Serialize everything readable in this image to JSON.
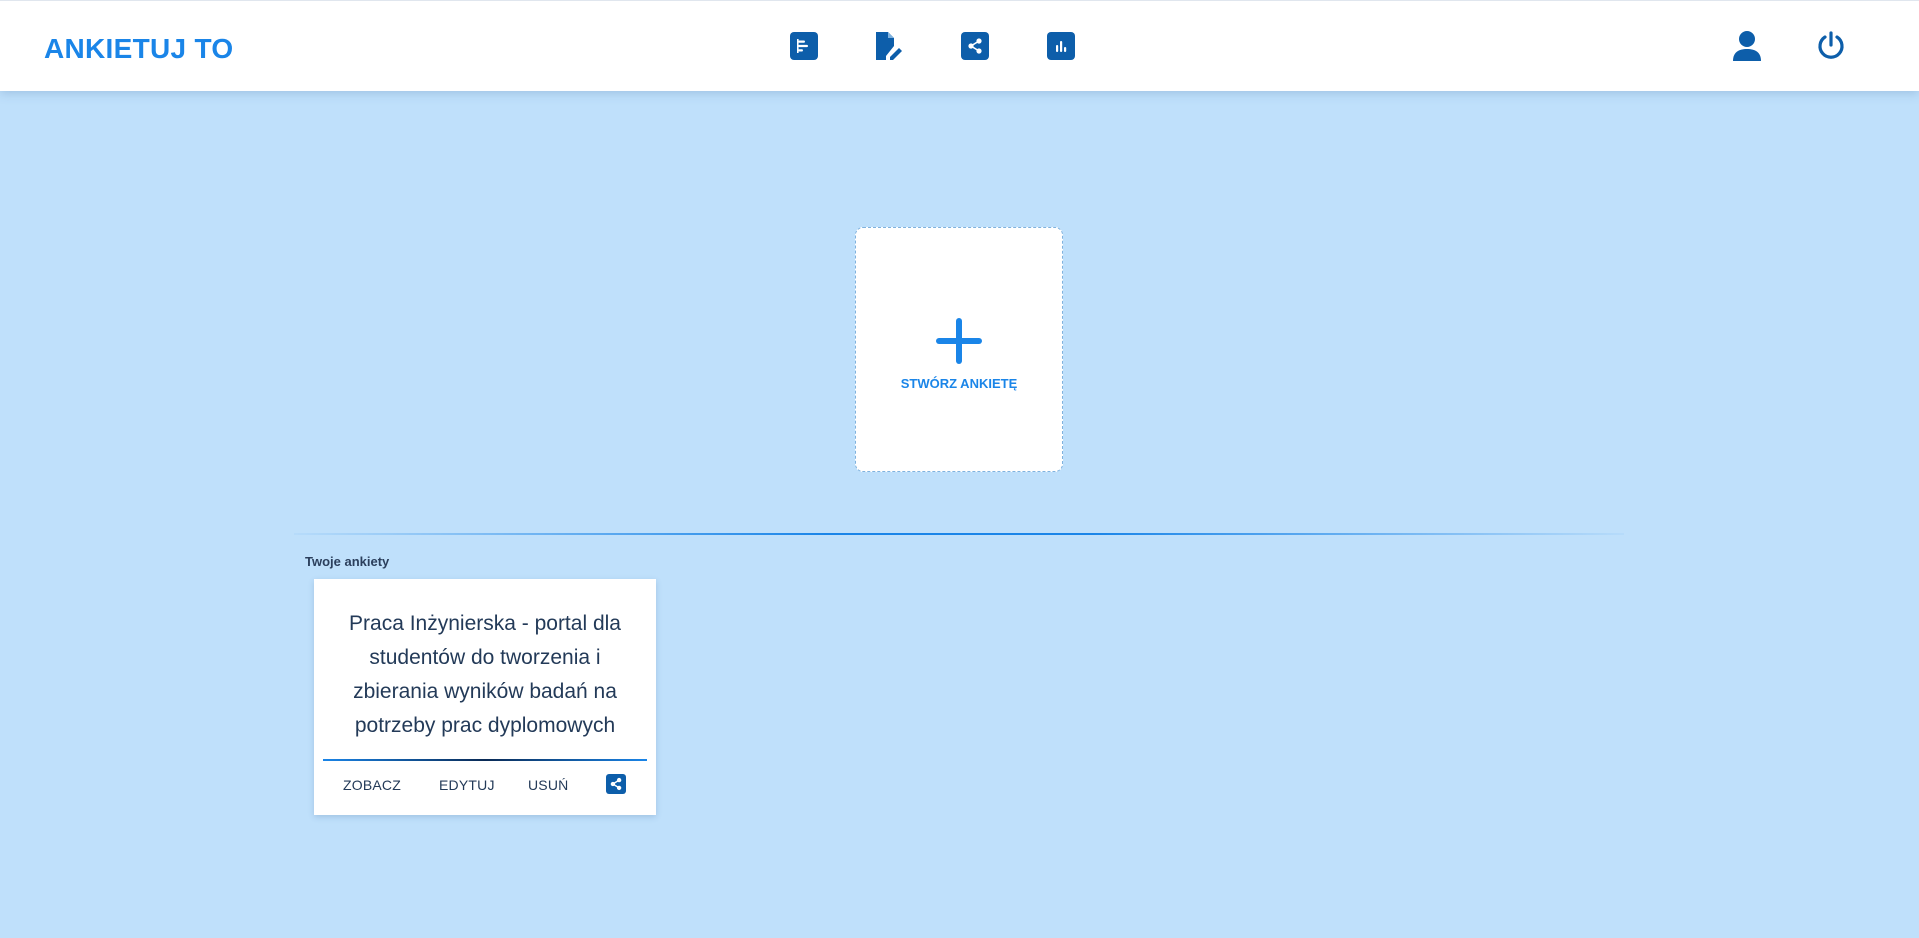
{
  "app": {
    "title": "ANKIETUJ TO"
  },
  "nav": {
    "icons": [
      "surveys-list-icon",
      "edit-document-icon",
      "share-icon",
      "bar-chart-icon"
    ],
    "right_icons": [
      "user-icon",
      "power-icon"
    ]
  },
  "create_card": {
    "label": "STWÓRZ ANKIETĘ",
    "icon": "plus-icon"
  },
  "section": {
    "title": "Twoje ankiety"
  },
  "surveys": [
    {
      "title": "Praca Inżynierska - portal dla studentów do tworzenia i zbierania wyników badań na potrzeby prac dyplomowych",
      "actions": {
        "view": "ZOBACZ",
        "edit": "EDYTUJ",
        "delete": "USUŃ"
      },
      "share_icon": "share-icon"
    }
  ],
  "colors": {
    "background": "#bfe0fb",
    "accent": "#1a85e8",
    "icon_dark": "#0d5eaa",
    "text_dark": "#233a58"
  }
}
